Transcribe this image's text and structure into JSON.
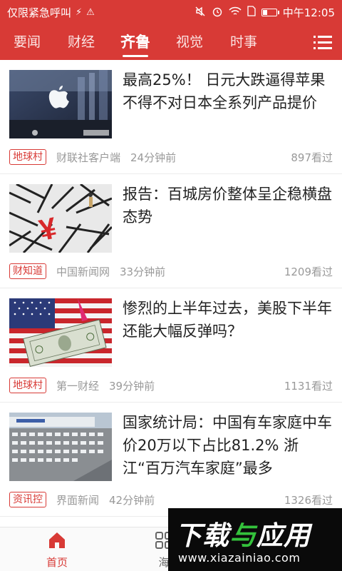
{
  "status_bar": {
    "left_text": "仅限紧急呼叫",
    "time": "中午12:05",
    "icons": [
      "charging-bolt-icon",
      "warning-icon",
      "mute-icon",
      "alarm-icon",
      "wifi-icon",
      "sim-icon",
      "battery-icon"
    ],
    "battery_level": 0.3
  },
  "tabs": [
    {
      "label": "要闻",
      "active": false
    },
    {
      "label": "财经",
      "active": false
    },
    {
      "label": "齐鲁",
      "active": true
    },
    {
      "label": "视觉",
      "active": false
    },
    {
      "label": "时事",
      "active": false
    }
  ],
  "feed": [
    {
      "title": "最高25%！ 日元大跌逼得苹果不得不对日本全系列产品提价",
      "tag": "地球村",
      "source": "财联社客户端",
      "time": "24分钟前",
      "views": "897看过"
    },
    {
      "title": "报告：百城房价整体呈企稳横盘态势",
      "tag": "财知道",
      "source": "中国新闻网",
      "time": "33分钟前",
      "views": "1209看过"
    },
    {
      "title": "惨烈的上半年过去，美股下半年还能大幅反弹吗？",
      "tag": "地球村",
      "source": "第一财经",
      "time": "39分钟前",
      "views": "1131看过"
    },
    {
      "title": "国家统计局：中国有车家庭中车价20万以下占比81.2% 浙江“百万汽车家庭”最多",
      "tag": "资讯控",
      "source": "界面新闻",
      "time": "42分钟前",
      "views": "1326看过"
    }
  ],
  "bottom_nav": [
    {
      "label": "首页",
      "active": true,
      "icon": "home-icon"
    },
    {
      "label": "海",
      "active": false,
      "icon": "grid-icon"
    }
  ],
  "watermark": {
    "logo_part1": "下载",
    "logo_part2": "与",
    "logo_part3": "应用",
    "url": "www.xiazainiao.com"
  },
  "colors": {
    "brand_red": "#d83a36",
    "text_dark": "#222222",
    "text_gray": "#999999"
  }
}
